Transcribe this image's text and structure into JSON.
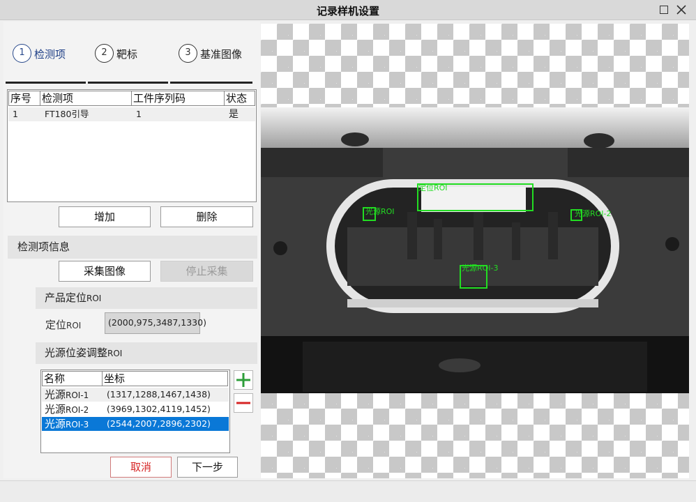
{
  "window": {
    "title": "记录样机设置"
  },
  "steps": [
    {
      "num": "1",
      "label": "检测项"
    },
    {
      "num": "2",
      "label": "靶标"
    },
    {
      "num": "3",
      "label": "基准图像"
    }
  ],
  "items_table": {
    "headers": [
      "序号",
      "检测项",
      "工件序列码",
      "状态"
    ],
    "rows": [
      {
        "index": "1",
        "name": "FT180引导",
        "serial": "1",
        "status": "是"
      }
    ]
  },
  "buttons": {
    "add": "增加",
    "delete": "删除",
    "capture": "采集图像",
    "stop_capture": "停止采集",
    "cancel": "取消",
    "next": "下一步"
  },
  "info_section": {
    "title": "检测项信息"
  },
  "product_roi": {
    "title_main": "产品定位",
    "title_suffix": "ROI",
    "label_main": "定位",
    "label_suffix": "ROI",
    "value": "(2000,975,3487,1330)"
  },
  "light_roi": {
    "title_main": "光源位姿调整",
    "title_suffix": "ROI",
    "headers": [
      "名称",
      "坐标"
    ],
    "rows": [
      {
        "name_main": "光源",
        "name_suffix": "ROI-1",
        "coord": "(1317,1288,1467,1438)"
      },
      {
        "name_main": "光源",
        "name_suffix": "ROI-2",
        "coord": "(3969,1302,4119,1452)"
      },
      {
        "name_main": "光源",
        "name_suffix": "ROI-3",
        "coord": "(2544,2007,2896,2302)"
      }
    ],
    "selected_index": 2
  },
  "viewer": {
    "overlay_labels": {
      "locate": "定位ROI",
      "roi1": "光源ROI",
      "roi2": "光源ROI-2",
      "roi3": "光源ROI-3"
    },
    "overlay_color": "#22dd22"
  },
  "icons": {
    "maximize": "maximize-icon",
    "close": "close-icon",
    "add": "plus-icon",
    "remove": "minus-icon"
  },
  "colors": {
    "accent": "#0a78d7",
    "plus": "#2e9e3a",
    "minus": "#d62424"
  }
}
